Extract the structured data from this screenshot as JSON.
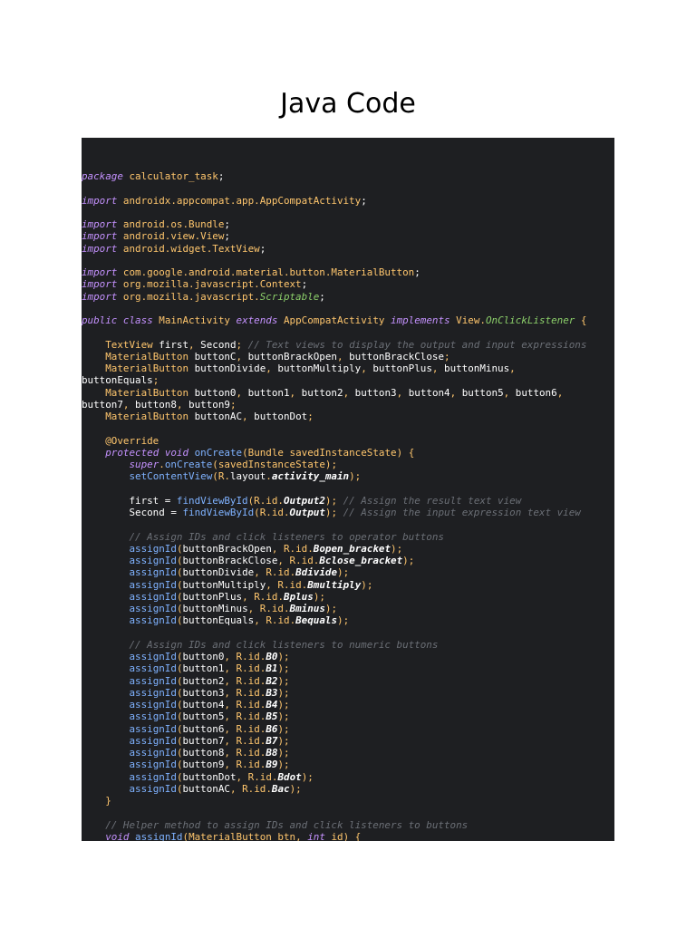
{
  "title": "Java Code",
  "code": [
    "package calculator_task;",
    "",
    "import androidx.appcompat.app.AppCompatActivity;",
    "",
    "import android.os.Bundle;",
    "import android.view.View;",
    "import android.widget.TextView;",
    "",
    "import com.google.android.material.button.MaterialButton;",
    "import org.mozilla.javascript.Context;",
    "import org.mozilla.javascript.Scriptable;",
    "",
    "public class MainActivity extends AppCompatActivity implements View.OnClickListener {",
    "",
    "    TextView first, Second; // Text views to display the output and input expressions",
    "    MaterialButton buttonC, buttonBrackOpen, buttonBrackClose;",
    "    MaterialButton buttonDivide, buttonMultiply, buttonPlus, buttonMinus,",
    "buttonEquals;",
    "    MaterialButton button0, button1, button2, button3, button4, button5, button6,",
    "button7, button8, button9;",
    "    MaterialButton buttonAC, buttonDot;",
    "",
    "    @Override",
    "    protected void onCreate(Bundle savedInstanceState) {",
    "        super.onCreate(savedInstanceState);",
    "        setContentView(R.layout.activity_main);",
    "",
    "        first = findViewById(R.id.Output2); // Assign the result text view",
    "        Second = findViewById(R.id.Output); // Assign the input expression text view",
    "",
    "        // Assign IDs and click listeners to operator buttons",
    "        assignId(buttonBrackOpen, R.id.Bopen_bracket);",
    "        assignId(buttonBrackClose, R.id.Bclose_bracket);",
    "        assignId(buttonDivide, R.id.Bdivide);",
    "        assignId(buttonMultiply, R.id.Bmultiply);",
    "        assignId(buttonPlus, R.id.Bplus);",
    "        assignId(buttonMinus, R.id.Bminus);",
    "        assignId(buttonEquals, R.id.Bequals);",
    "",
    "        // Assign IDs and click listeners to numeric buttons",
    "        assignId(button0, R.id.B0);",
    "        assignId(button1, R.id.B1);",
    "        assignId(button2, R.id.B2);",
    "        assignId(button3, R.id.B3);",
    "        assignId(button4, R.id.B4);",
    "        assignId(button5, R.id.B5);",
    "        assignId(button6, R.id.B6);",
    "        assignId(button7, R.id.B7);",
    "        assignId(button8, R.id.B8);",
    "        assignId(button9, R.id.B9);",
    "        assignId(buttonDot, R.id.Bdot);",
    "        assignId(buttonAC, R.id.Bac);",
    "    }",
    "",
    "    // Helper method to assign IDs and click listeners to buttons",
    "    void assignId(MaterialButton btn, int id) {"
  ],
  "colors": {
    "page_background": "#ffffff",
    "code_background": "#1e1f22",
    "keyword": "#c592ff",
    "type": "#ffc66d",
    "method": "#7fb2ff",
    "comment": "#6b6f76",
    "plain": "#ffffff"
  }
}
